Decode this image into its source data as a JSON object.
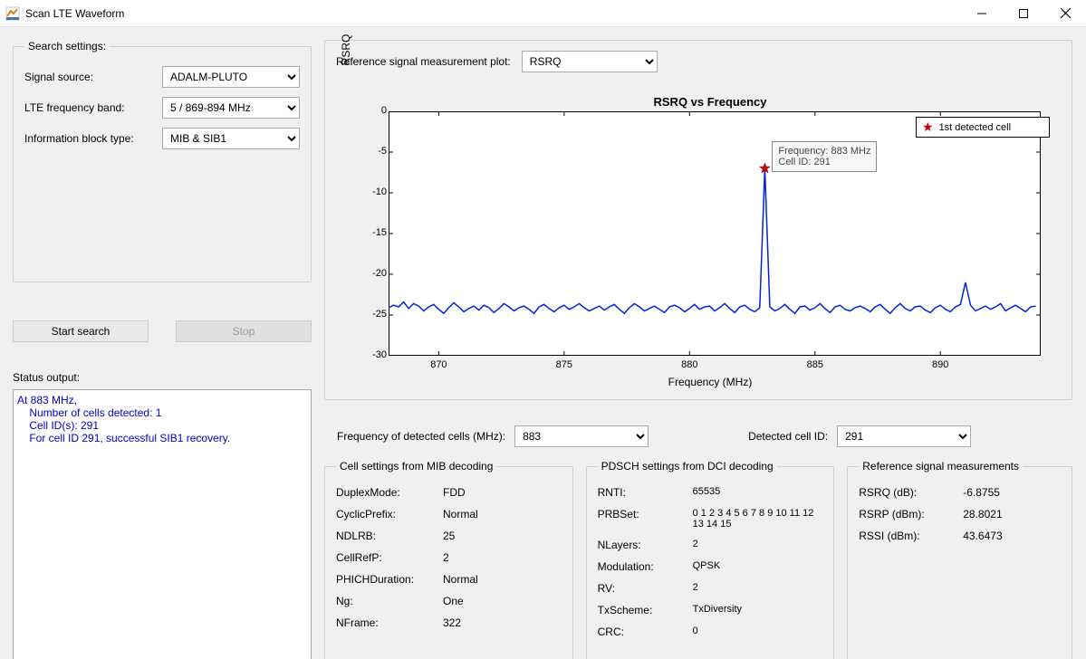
{
  "window": {
    "title": "Scan LTE Waveform"
  },
  "search_settings": {
    "legend": "Search settings:",
    "signal_source_label": "Signal source:",
    "signal_source_value": "ADALM-PLUTO",
    "freq_band_label": "LTE frequency band:",
    "freq_band_value": "5 / 869-894 MHz",
    "info_block_label": "Information block type:",
    "info_block_value": "MIB & SIB1"
  },
  "buttons": {
    "start": "Start search",
    "stop": "Stop"
  },
  "status": {
    "label": "Status output:",
    "text": "At 883 MHz,\n    Number of cells detected: 1\n    Cell ID(s): 291\n    For cell ID 291, successful SIB1 recovery."
  },
  "plot_panel": {
    "label": "Reference signal measurement plot:",
    "value": "RSRQ"
  },
  "detected": {
    "freq_label": "Frequency of detected cells (MHz):",
    "freq_value": "883",
    "cell_label": "Detected cell ID:",
    "cell_value": "291"
  },
  "mib": {
    "legend": "Cell settings from MIB decoding",
    "items": [
      {
        "k": "DuplexMode:",
        "v": "FDD"
      },
      {
        "k": "CyclicPrefix:",
        "v": "Normal"
      },
      {
        "k": "NDLRB:",
        "v": "25"
      },
      {
        "k": "CellRefP:",
        "v": "2"
      },
      {
        "k": "PHICHDuration:",
        "v": "Normal"
      },
      {
        "k": "Ng:",
        "v": "One"
      },
      {
        "k": "NFrame:",
        "v": "322"
      }
    ]
  },
  "pdsch": {
    "legend": "PDSCH settings from DCI decoding",
    "items": [
      {
        "k": "RNTI:",
        "v": "65535"
      },
      {
        "k": "PRBSet:",
        "v": "0  1  2  3  4  5  6  7  8  9  10  11  12  13  14  15"
      },
      {
        "k": "NLayers:",
        "v": "2"
      },
      {
        "k": "Modulation:",
        "v": "QPSK"
      },
      {
        "k": "RV:",
        "v": "2"
      },
      {
        "k": "TxScheme:",
        "v": "TxDiversity"
      },
      {
        "k": "CRC:",
        "v": "0"
      }
    ]
  },
  "ref_meas": {
    "legend": "Reference signal measurements",
    "items": [
      {
        "k": "RSRQ (dB):",
        "v": "-6.8755"
      },
      {
        "k": "RSRP (dBm):",
        "v": "28.8021"
      },
      {
        "k": "RSSI (dBm):",
        "v": "43.6473"
      }
    ]
  },
  "chart_data": {
    "type": "line",
    "title": "RSRQ vs Frequency",
    "xlabel": "Frequency (MHz)",
    "ylabel": "RSRQ",
    "xlim": [
      868,
      894
    ],
    "ylim": [
      -30,
      0
    ],
    "xticks": [
      870,
      875,
      880,
      885,
      890
    ],
    "yticks": [
      0,
      -5,
      -10,
      -15,
      -20,
      -25,
      -30
    ],
    "legend": "1st detected cell",
    "tooltip": {
      "lines": [
        "Frequency: 883 MHz",
        "Cell ID: 291"
      ],
      "x": 883,
      "y": -7
    },
    "marker": {
      "x": 883,
      "y": -7
    },
    "series": [
      {
        "name": "RSRQ",
        "x_step": 0.2,
        "x_start": 868,
        "values": [
          -24.1,
          -23.8,
          -24.0,
          -23.4,
          -24.2,
          -23.6,
          -23.9,
          -24.5,
          -24.0,
          -23.7,
          -24.3,
          -24.8,
          -24.1,
          -23.5,
          -24.0,
          -24.6,
          -24.2,
          -23.9,
          -24.4,
          -23.8,
          -24.1,
          -24.7,
          -24.2,
          -23.6,
          -24.0,
          -24.5,
          -24.1,
          -23.9,
          -24.3,
          -24.8,
          -24.0,
          -23.7,
          -24.2,
          -24.6,
          -24.1,
          -23.8,
          -24.3,
          -24.0,
          -23.6,
          -24.1,
          -24.5,
          -24.2,
          -23.9,
          -24.4,
          -24.0,
          -23.7,
          -24.3,
          -24.8,
          -24.1,
          -23.6,
          -24.0,
          -24.5,
          -24.2,
          -23.9,
          -24.3,
          -24.7,
          -24.0,
          -23.8,
          -24.1,
          -24.6,
          -24.2,
          -23.7,
          -24.3,
          -24.0,
          -23.9,
          -24.5,
          -24.1,
          -23.6,
          -24.2,
          -24.7,
          -24.0,
          -23.8,
          -24.3,
          -24.6,
          -24.1,
          -7.0,
          -24.0,
          -24.5,
          -24.2,
          -23.7,
          -24.3,
          -24.8,
          -24.0,
          -23.9,
          -24.4,
          -24.1,
          -23.6,
          -24.2,
          -24.7,
          -24.0,
          -23.8,
          -24.3,
          -24.5,
          -24.1,
          -23.9,
          -24.2,
          -24.6,
          -24.0,
          -23.7,
          -24.3,
          -24.8,
          -24.1,
          -23.6,
          -24.2,
          -24.5,
          -24.0,
          -23.9,
          -24.4,
          -24.7,
          -24.1,
          -23.8,
          -24.3,
          -24.6,
          -24.0,
          -23.7,
          -21.0,
          -23.8,
          -24.5,
          -24.2,
          -23.9,
          -24.3,
          -24.0,
          -23.6,
          -24.5,
          -24.1,
          -23.8,
          -24.2,
          -24.6,
          -24.0,
          -23.9
        ]
      }
    ]
  }
}
